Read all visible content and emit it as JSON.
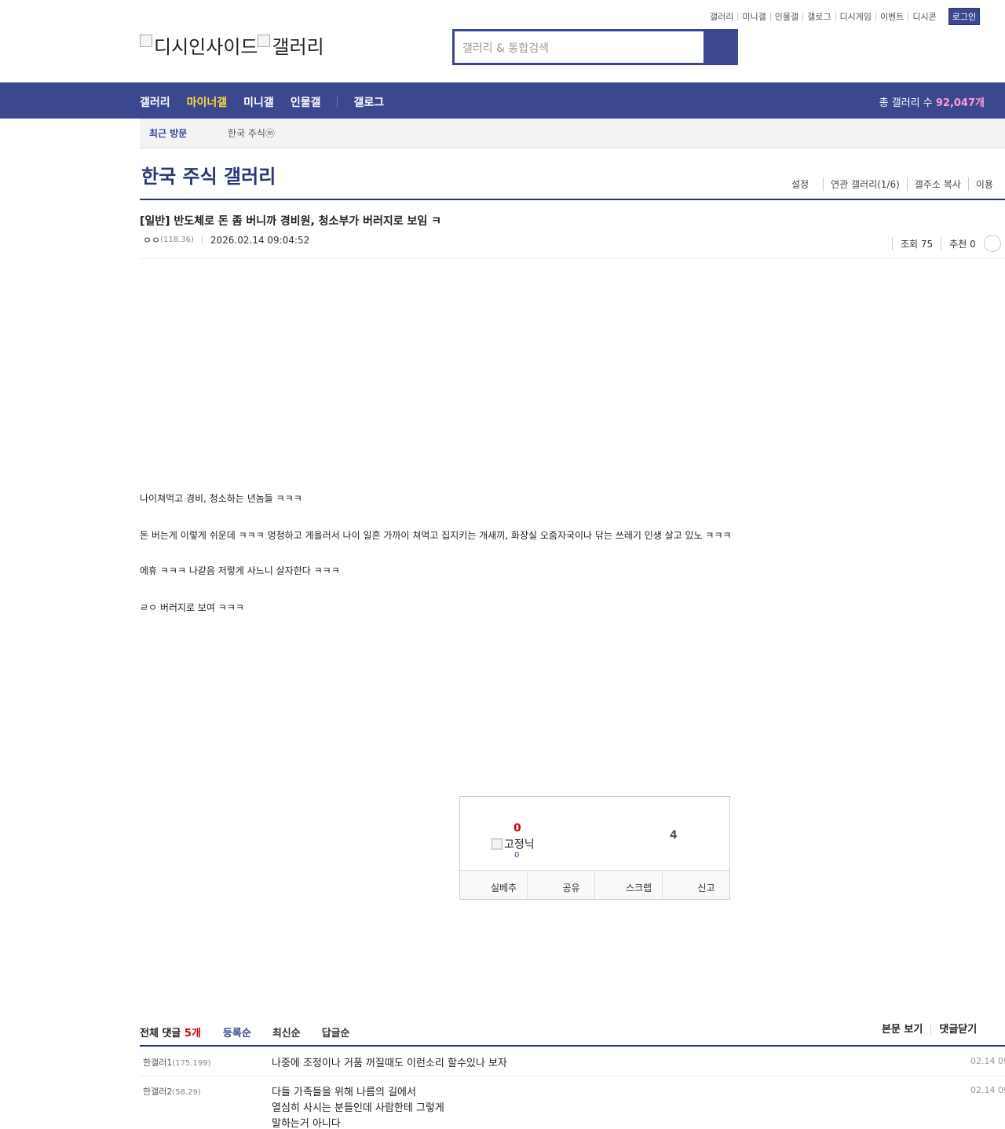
{
  "util_links": [
    "갤러리",
    "미니갤",
    "인물갤",
    "갤로그",
    "디시게임",
    "이벤트",
    "디시콘"
  ],
  "login_label": "로그인",
  "logo": {
    "site": "디시인사이드",
    "section": "갤러리"
  },
  "search": {
    "placeholder": "갤러리 & 통합검색"
  },
  "gnb": {
    "items": [
      "갤러리",
      "마이너갤",
      "미니갤",
      "인물갤"
    ],
    "active": "마이너갤",
    "gallog": "갤로그",
    "count_label": "총 갤러리 수",
    "count_value": "92,047개"
  },
  "recent": {
    "label": "최근 방문",
    "item": "한국 주식ⓜ"
  },
  "gallery": {
    "title": "한국 주식 갤러리",
    "options": [
      "설정",
      "연관 갤러리(1/6)",
      "갤주소 복사",
      "이용"
    ]
  },
  "post": {
    "title": "[일반] 반도체로 돈 좀 버니까 경비원, 청소부가 버러지로 보임 ㅋ",
    "author": "ㅇㅇ",
    "author_ip": "(118.36)",
    "date": "2026.02.14 09:04:52",
    "views_label": "조회 75",
    "recommend_label": "추천 0",
    "body": [
      "나이쳐먹고 경비, 청소하는 년놈들 ㅋㅋㅋ",
      "돈 버는게 이렇게 쉬운데 ㅋㅋㅋ 멍청하고 게을러서 나이 일흔 가까이 쳐먹고 집지키는 개새끼, 화장실 오줌자국이나 닦는 쓰레기 인생 살고 있노 ㅋㅋㅋ",
      "에휴 ㅋㅋㅋ 나같음 저렇게 사느니 살자한다 ㅋㅋㅋ",
      "ㄹㅇ 버러지로 보여 ㅋㅋㅋ"
    ]
  },
  "vote": {
    "up": "0",
    "fixed_label": "고정닉",
    "fixed_count": "0",
    "down": "4",
    "buttons": [
      "실베추",
      "공유",
      "스크랩",
      "신고"
    ]
  },
  "comments_header": {
    "total_label": "전체 댓글",
    "total_count": "5개",
    "sorts": [
      "등록순",
      "최신순",
      "답글순"
    ],
    "right": [
      "본문 보기",
      "댓글닫기",
      ""
    ]
  },
  "comments": [
    {
      "nick": "한갤러1",
      "ip": "(175.199)",
      "lines": [
        "나중에 조정이나 거품 꺼질때도 이런소리 할수있나 보자"
      ],
      "date": "02.14 09"
    },
    {
      "nick": "한갤러2",
      "ip": "(58.29)",
      "lines": [
        "다들 가족들을 위해 나름의 길에서",
        "열심히 사시는 분들인데 사람한테 그렇게",
        "말하는거 아니다"
      ],
      "date": "02.14 09"
    }
  ],
  "colors": {
    "brand": "#3b4890",
    "brand_dark": "#29367c",
    "active_menu": "#ffdc3c",
    "count": "#ff9cd6",
    "up": "#cc0000"
  }
}
